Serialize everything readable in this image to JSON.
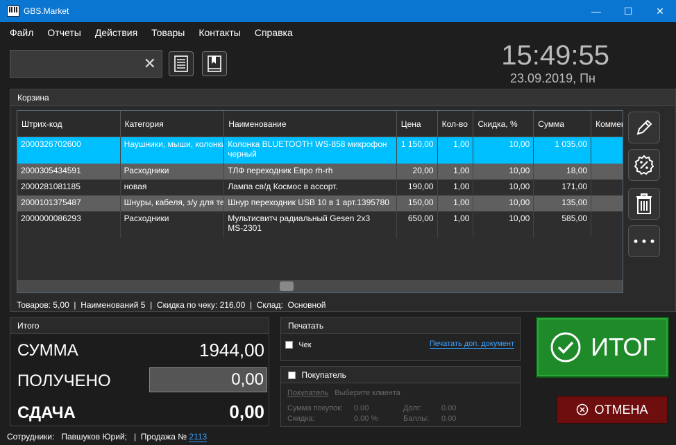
{
  "window": {
    "title": "GBS.Market",
    "minimize": "—",
    "maximize": "☐",
    "close": "✕"
  },
  "menu": [
    "Файл",
    "Отчеты",
    "Действия",
    "Товары",
    "Контакты",
    "Справка"
  ],
  "search": {
    "value": "",
    "clear": "✕"
  },
  "clock": {
    "time": "15:49:55",
    "date": "23.09.2019, Пн"
  },
  "cart": {
    "title": "Корзина",
    "columns": [
      "Штрих-код",
      "Категория",
      "Наименование",
      "Цена",
      "Кол-во",
      "Скидка, %",
      "Сумма",
      "Комментарий"
    ],
    "rows": [
      {
        "code": "2000326702600",
        "cat": "Наушники, мыши, колонки",
        "name": "Колонка BLUETOOTH WS-858 микрофон",
        "name2": "черный",
        "price": "1 150,00",
        "qty": "1,00",
        "disc": "10,00",
        "sum": "1 035,00",
        "style": "sel"
      },
      {
        "code": "2000305434591",
        "cat": "Расходники",
        "name": "ТЛФ переходник Евро rh-rh",
        "name2": "",
        "price": "20,00",
        "qty": "1,00",
        "disc": "10,00",
        "sum": "18,00",
        "style": "alt"
      },
      {
        "code": "2000281081185",
        "cat": "новая",
        "name": "Лампа св/д Космос в ассорт.",
        "name2": "",
        "price": "190,00",
        "qty": "1,00",
        "disc": "10,00",
        "sum": "171,00",
        "style": "norm"
      },
      {
        "code": "2000101375487",
        "cat": "Шнуры, кабеля, з/у для телефонов",
        "name": "Шнур переходник USB 10 в 1 арт.1395780",
        "name2": "",
        "price": "150,00",
        "qty": "1,00",
        "disc": "10,00",
        "sum": "135,00",
        "style": "alt"
      },
      {
        "code": "2000000086293",
        "cat": "Расходники",
        "name": "Мультисвитч радиальный  Gesen 2x3",
        "name2": "MS-2301",
        "price": "650,00",
        "qty": "1,00",
        "disc": "10,00",
        "sum": "585,00",
        "style": "norm"
      }
    ],
    "status": {
      "items_label": "Товаров:",
      "items_value": "5,00",
      "names_label": "Наименований",
      "names_value": "5",
      "discount_label": "Скидка по чеку:",
      "discount_value": "216,00",
      "store_label": "Склад:",
      "store_value": "Основной",
      "sep": "|"
    }
  },
  "total": {
    "title": "Итого",
    "sum_label": "СУММА",
    "sum_value": "1944,00",
    "received_label": "ПОЛУЧЕНО",
    "received_value": "0,00",
    "change_label": "СДАЧА",
    "change_value": "0,00"
  },
  "print": {
    "title": "Печатать",
    "receipt_label": "Чек",
    "extra_doc_link": "Печатать доп. документ"
  },
  "buyer": {
    "title": "Покупатель",
    "buyer_label": "Покупатель",
    "choose_client": "Выберите клиента",
    "purchases_label": "Сумма покупок:",
    "purchases_value": "0.00",
    "debt_label": "Долг:",
    "debt_value": "0.00",
    "discount_label": "Скидка:",
    "discount_value": "0.00 %",
    "points_label": "Баллы:",
    "points_value": "0.00"
  },
  "itog_label": "ИТОГ",
  "cancel_label": "ОТМЕНА",
  "footer": {
    "employees_label": "Сотрудники:",
    "employees_value": "Павшуков Юрий;",
    "sep": "|",
    "sale_label": "Продажа №",
    "sale_number": "2113"
  },
  "colors": {
    "accent": "#0b76d1",
    "selected_row": "#00bfff",
    "itog": "#1f8a2a",
    "cancel": "#6e0e0e",
    "link": "#3aa0ff"
  },
  "icons": [
    "app-icon",
    "clear-icon",
    "receipt-list-icon",
    "bookmark-book-icon",
    "pencil-icon",
    "discount-badge-icon",
    "trash-icon",
    "more-icon",
    "check-circle-icon",
    "cancel-circle-icon"
  ]
}
